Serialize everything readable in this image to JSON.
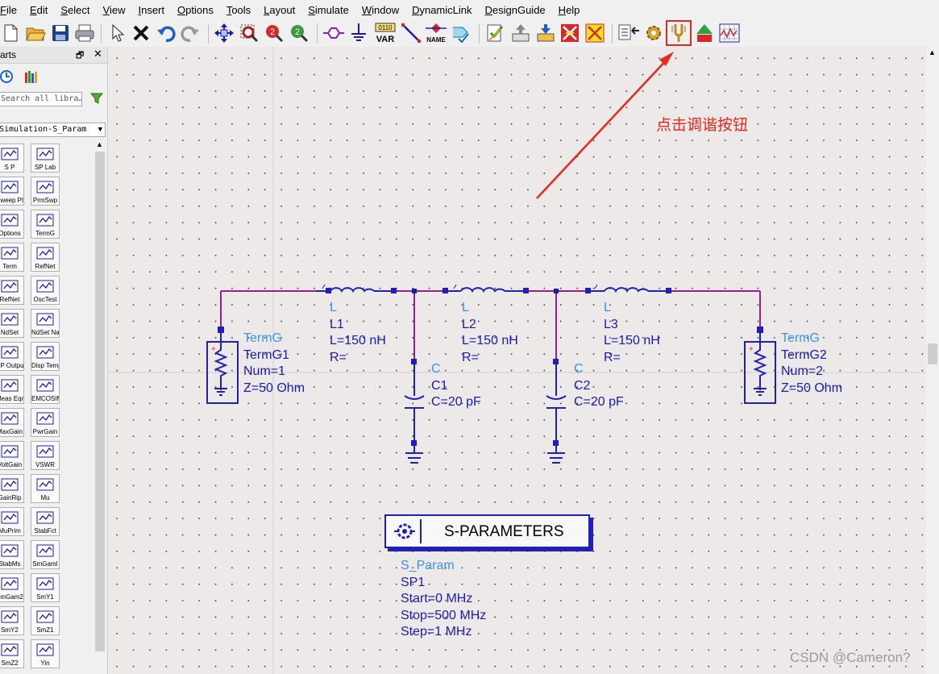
{
  "menu": [
    "File",
    "Edit",
    "Select",
    "View",
    "Insert",
    "Options",
    "Tools",
    "Layout",
    "Simulate",
    "Window",
    "DynamicLink",
    "DesignGuide",
    "Help"
  ],
  "toolbar": {
    "var_label": "VAR",
    "var_top": "0110",
    "name_label": "NAME",
    "highlighted": "tuning-button"
  },
  "parts": {
    "title": "Parts",
    "search_placeholder": "Search all libra…",
    "library": "Simulation-S_Param",
    "float_glyph": "🗗",
    "close_glyph": "✕",
    "items": [
      {
        "label": "S P",
        "icon": "sp-icon"
      },
      {
        "label": "SP Lab",
        "icon": "sp-lab-icon"
      },
      {
        "label": "Sweep Plan",
        "icon": "sweep-plan-icon"
      },
      {
        "label": "PrmSwp",
        "icon": "param-sweep-icon"
      },
      {
        "label": "Options",
        "icon": "options-icon"
      },
      {
        "label": "TermG",
        "icon": "termg-icon"
      },
      {
        "label": "Term",
        "icon": "term-icon"
      },
      {
        "label": "RefNet",
        "icon": "refnet-icon"
      },
      {
        "label": "RefNet",
        "icon": "refnet-icon"
      },
      {
        "label": "OscTest",
        "icon": "osctest-icon"
      },
      {
        "label": "NdSet",
        "icon": "ndset-icon"
      },
      {
        "label": "NdSet Name",
        "icon": "ndset-name-icon"
      },
      {
        "label": "SP Output",
        "icon": "sp-output-icon"
      },
      {
        "label": "Disp Temp",
        "icon": "disp-temp-icon"
      },
      {
        "label": "Meas Eqn",
        "icon": "meas-eqn-icon"
      },
      {
        "label": "EMCOSIM",
        "icon": "emcosim-icon"
      },
      {
        "label": "MaxGain",
        "icon": "maxgain-icon"
      },
      {
        "label": "PwrGain",
        "icon": "pwrgain-icon"
      },
      {
        "label": "VoltGain",
        "icon": "voltgain-icon"
      },
      {
        "label": "VSWR",
        "icon": "vswr-icon"
      },
      {
        "label": "GainRip",
        "icon": "gainrip-icon"
      },
      {
        "label": "Mu",
        "icon": "mu-icon"
      },
      {
        "label": "MuPrim",
        "icon": "muprim-icon"
      },
      {
        "label": "StabFct",
        "icon": "stabfct-icon"
      },
      {
        "label": "StabMs",
        "icon": "stabms-icon"
      },
      {
        "label": "SmGamI",
        "icon": "smgam1-icon"
      },
      {
        "label": "SmGam2",
        "icon": "smgam2-icon"
      },
      {
        "label": "SmY1",
        "icon": "smy1-icon"
      },
      {
        "label": "SmY2",
        "icon": "smy2-icon"
      },
      {
        "label": "SmZ1",
        "icon": "smz1-icon"
      },
      {
        "label": "SmZ2",
        "icon": "smz2-icon"
      },
      {
        "label": "Yin",
        "icon": "yin-icon"
      }
    ]
  },
  "schematic": {
    "termg1": {
      "type": "TermG",
      "name": "TermG1",
      "num": "Num=1",
      "z": "Z=50 Ohm"
    },
    "termg2": {
      "type": "TermG",
      "name": "TermG2",
      "num": "Num=2",
      "z": "Z=50 Ohm"
    },
    "l1": {
      "type": "L",
      "name": "L1",
      "value": "L=150 nH",
      "r": "R="
    },
    "l2": {
      "type": "L",
      "name": "L2",
      "value": "L=150 nH",
      "r": "R="
    },
    "l3": {
      "type": "L",
      "name": "L3",
      "value": "L=150 nH",
      "r": "R="
    },
    "c1": {
      "type": "C",
      "name": "C1",
      "value": "C=20 pF"
    },
    "c2": {
      "type": "C",
      "name": "C2",
      "value": "C=20 pF"
    },
    "sparam": {
      "title": "S-PARAMETERS",
      "type": "S_Param",
      "name": "SP1",
      "start": "Start=0 MHz",
      "stop": "Stop=500 MHz",
      "step": "Step=1 MHz"
    }
  },
  "annotation": "点击调谐按钮",
  "watermark": "CSDN @Cameron?",
  "colors": {
    "wire": "#9b1d8c",
    "component": "#2020b8",
    "annotation": "#e8271d",
    "label_type": "#3b94e6"
  }
}
